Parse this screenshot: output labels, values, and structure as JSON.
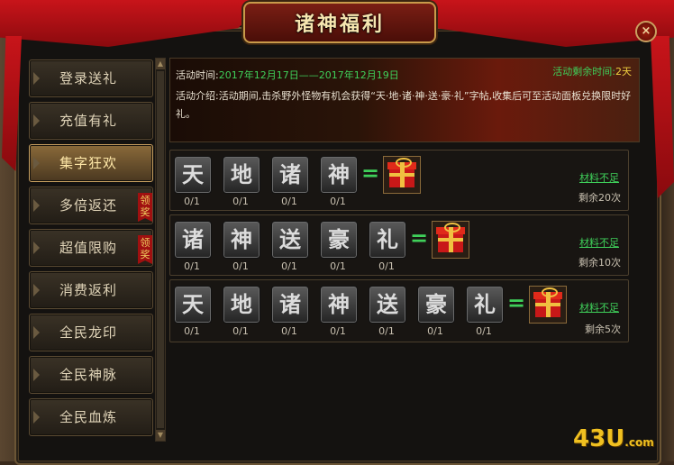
{
  "window": {
    "title": "诸神福利",
    "close_label": "×"
  },
  "sidebar": {
    "items": [
      {
        "label": "登录送礼",
        "active": false,
        "badge": ""
      },
      {
        "label": "充值有礼",
        "active": false,
        "badge": ""
      },
      {
        "label": "集字狂欢",
        "active": true,
        "badge": ""
      },
      {
        "label": "多倍返还",
        "active": false,
        "badge": "领奖"
      },
      {
        "label": "超值限购",
        "active": false,
        "badge": "领奖"
      },
      {
        "label": "消费返利",
        "active": false,
        "badge": ""
      },
      {
        "label": "全民龙印",
        "active": false,
        "badge": ""
      },
      {
        "label": "全民神脉",
        "active": false,
        "badge": ""
      },
      {
        "label": "全民血炼",
        "active": false,
        "badge": ""
      }
    ]
  },
  "event": {
    "time_label": "活动时间:",
    "time_value": "2017年12月17日——2017年12月19日",
    "remain_label": "活动剩余时间:",
    "remain_value": "2天",
    "desc": "活动介绍:活动期间,击杀野外怪物有机会获得“天·地·诸·神·送·豪·礼”字帖,收集后可至活动面板兑换限时好礼。"
  },
  "rows": [
    {
      "chars": [
        "天",
        "地",
        "诸",
        "神"
      ],
      "counts": [
        "0/1",
        "0/1",
        "0/1",
        "0/1"
      ],
      "equals": "=",
      "status": "材料不足",
      "remaining": "剩余20次"
    },
    {
      "chars": [
        "诸",
        "神",
        "送",
        "豪",
        "礼"
      ],
      "counts": [
        "0/1",
        "0/1",
        "0/1",
        "0/1",
        "0/1"
      ],
      "equals": "=",
      "status": "材料不足",
      "remaining": "剩余10次"
    },
    {
      "chars": [
        "天",
        "地",
        "诸",
        "神",
        "送",
        "豪",
        "礼"
      ],
      "counts": [
        "0/1",
        "0/1",
        "0/1",
        "0/1",
        "0/1",
        "0/1",
        "0/1"
      ],
      "equals": "=",
      "status": "材料不足",
      "remaining": "剩余5次"
    }
  ],
  "watermark": {
    "main": "43U",
    "suffix": ".com"
  },
  "colors": {
    "accent_green": "#3fd05a",
    "ribbon_red": "#c8141a",
    "gold": "#c99a4a"
  }
}
